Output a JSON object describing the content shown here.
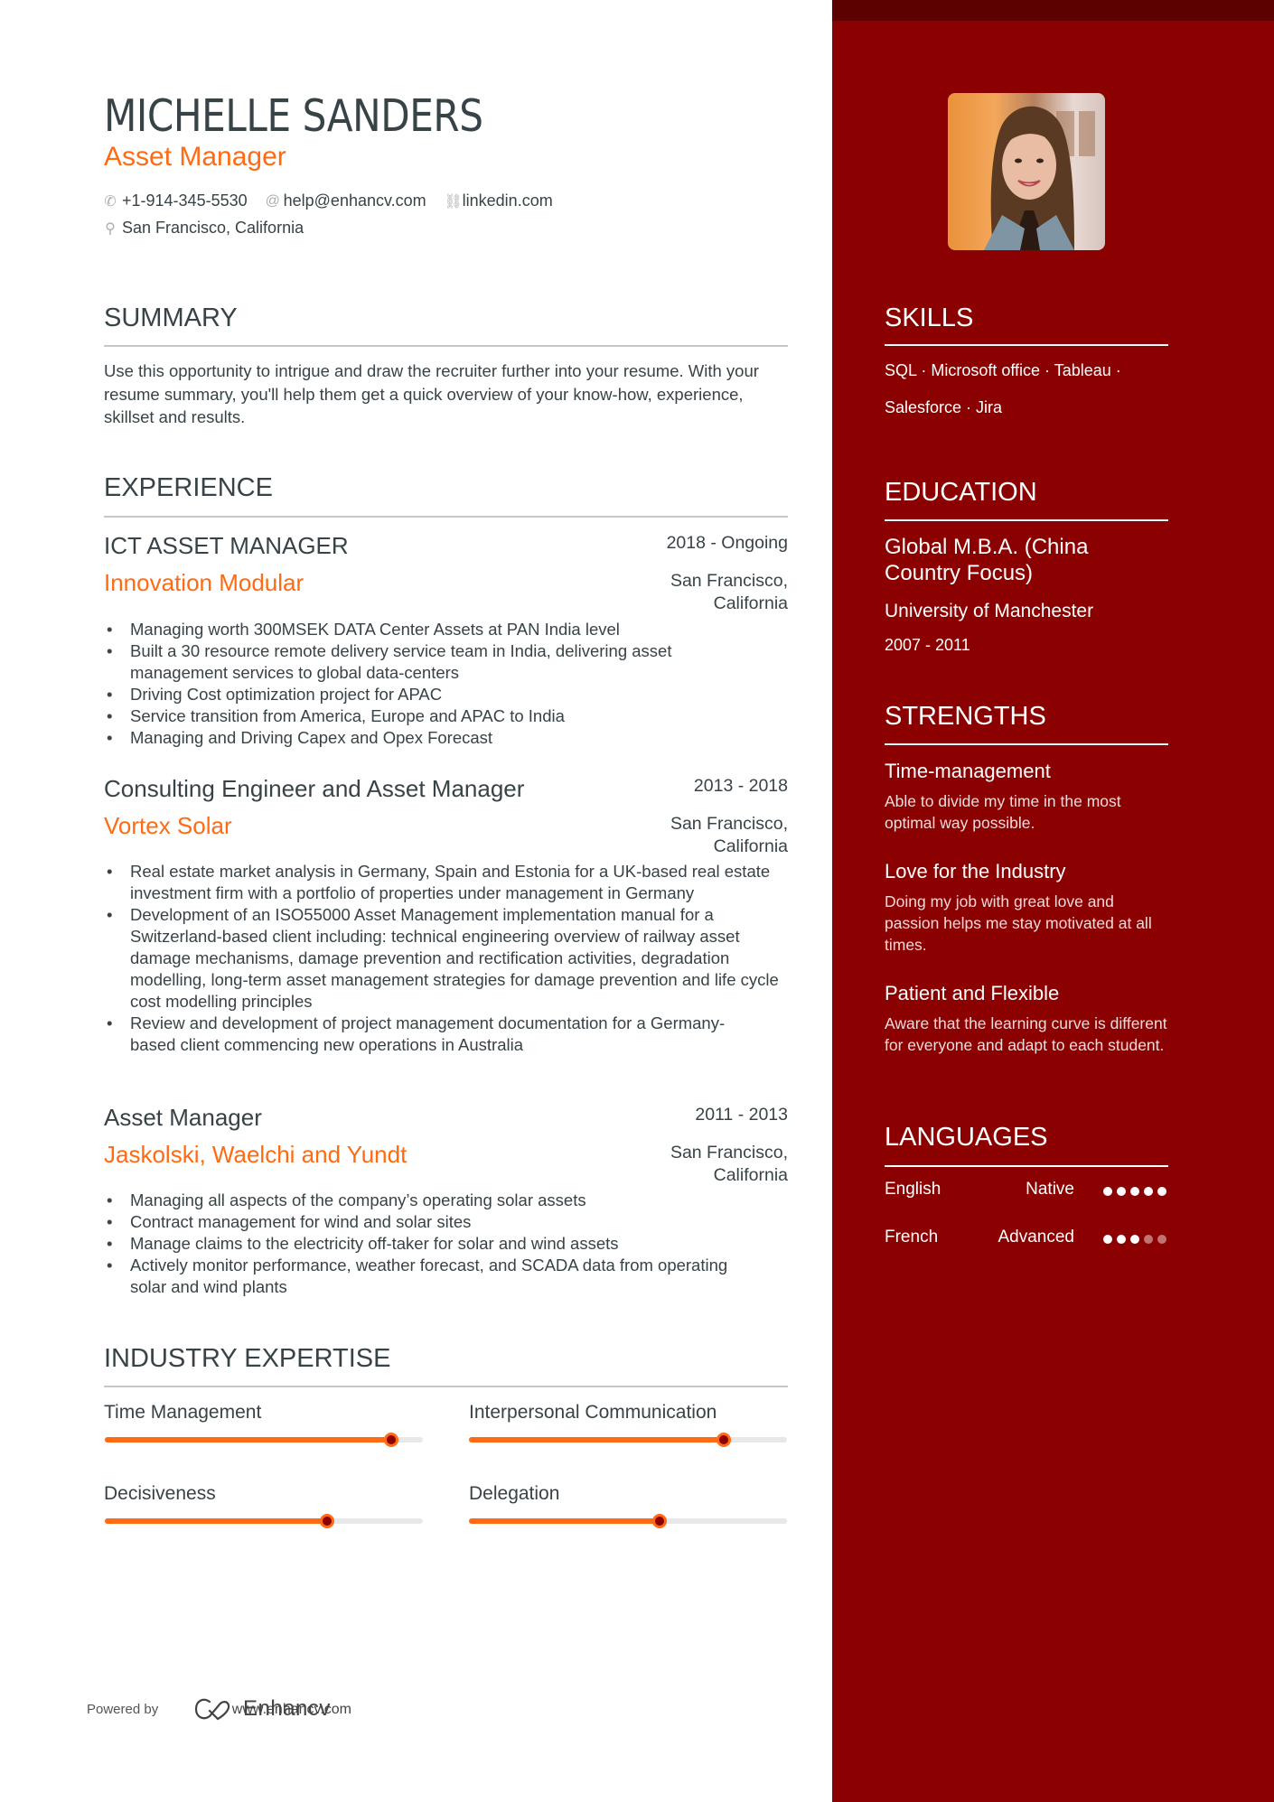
{
  "header": {
    "name": "MICHELLE SANDERS",
    "role": "Asset Manager",
    "contacts": [
      {
        "icon": "phone-icon",
        "glyph": "✆",
        "text": "+1-914-345-5530"
      },
      {
        "icon": "at-icon",
        "glyph": "@",
        "text": "help@enhancv.com"
      },
      {
        "icon": "link-icon",
        "glyph": "⛓",
        "text": "linkedin.com"
      }
    ],
    "location": {
      "icon": "location-pin-icon",
      "glyph": "⚲",
      "text": "San Francisco, California"
    }
  },
  "summary": {
    "title": "SUMMARY",
    "text": "Use this opportunity to intrigue and draw the recruiter further into your resume. With your resume summary, you'll help them get a quick overview of your know-how, experience, skillset and results."
  },
  "experience": {
    "title": "EXPERIENCE",
    "jobs": [
      {
        "title": "ICT ASSET MANAGER",
        "dates": "2018 - Ongoing",
        "company": "Innovation Modular",
        "location": "San Francisco, California",
        "bullets": [
          "Managing worth 300MSEK DATA Center Assets at PAN India level",
          "Built a 30 resource remote delivery service team in India, delivering asset management services to global data-centers",
          "Driving Cost optimization project for APAC",
          "Service transition from America, Europe and APAC to India",
          "Managing and Driving Capex and Opex Forecast"
        ]
      },
      {
        "title": "Consulting Engineer and Asset Manager",
        "dates": "2013 - 2018",
        "company": "Vortex Solar",
        "location": "San Francisco, California",
        "bullets": [
          "Real estate market analysis in Germany, Spain and Estonia for a UK-based real estate investment firm with a portfolio of properties under management in Germany",
          "Development of an ISO55000 Asset Management implementation manual for a Switzerland-based client including: technical engineering overview of railway asset damage mechanisms, damage prevention and rectification activities, degradation modelling, long-term asset management strategies for damage prevention and life cycle cost modelling principles",
          "Review and development of project management documentation for a Germany-based client commencing new operations in Australia"
        ]
      },
      {
        "title": "Asset Manager",
        "dates": "2011 - 2013",
        "company": "Jaskolski, Waelchi and Yundt",
        "location": "San Francisco, California",
        "bullets": [
          "Managing all aspects of the company’s operating solar assets",
          "Contract management for wind and solar sites",
          "Manage claims to the electricity off-taker for solar and wind assets",
          "Actively monitor performance, weather forecast, and SCADA data from operating solar and wind plants"
        ]
      }
    ]
  },
  "expertise": {
    "title": "INDUSTRY EXPERTISE",
    "items": [
      {
        "label": "Time Management",
        "level": 0.9
      },
      {
        "label": "Interpersonal Communication",
        "level": 0.8
      },
      {
        "label": "Decisiveness",
        "level": 0.7
      },
      {
        "label": "Delegation",
        "level": 0.6
      }
    ]
  },
  "footer": {
    "powered_by": "Powered by",
    "logo_text": "Enhancv",
    "url": "www.enhancv.com"
  },
  "sidebar": {
    "skills": {
      "title": "SKILLS",
      "line1": "SQL · Microsoft office · Tableau ·",
      "line2": "Salesforce · Jira"
    },
    "education": {
      "title": "EDUCATION",
      "degree": "Global M.B.A. (China Country Focus)",
      "school": "University of Manchester",
      "dates": "2007 - 2011"
    },
    "strengths": {
      "title": "STRENGTHS",
      "items": [
        {
          "title": "Time-management",
          "desc": "Able to divide my time in the most optimal way possible."
        },
        {
          "title": "Love for the Industry",
          "desc": "Doing my job with great love and passion helps me stay motivated at all times."
        },
        {
          "title": "Patient and Flexible",
          "desc": "Aware that the learning curve is different for everyone and adapt to each student."
        }
      ]
    },
    "languages": {
      "title": "LANGUAGES",
      "items": [
        {
          "name": "English",
          "level": "Native",
          "dots": 5,
          "max": 5
        },
        {
          "name": "French",
          "level": "Advanced",
          "dots": 3,
          "max": 5
        }
      ]
    }
  },
  "colors": {
    "accent": "#ff6a13",
    "sidebar": "#8b0000",
    "sidebar_band": "#5d0000",
    "text": "#384347"
  }
}
